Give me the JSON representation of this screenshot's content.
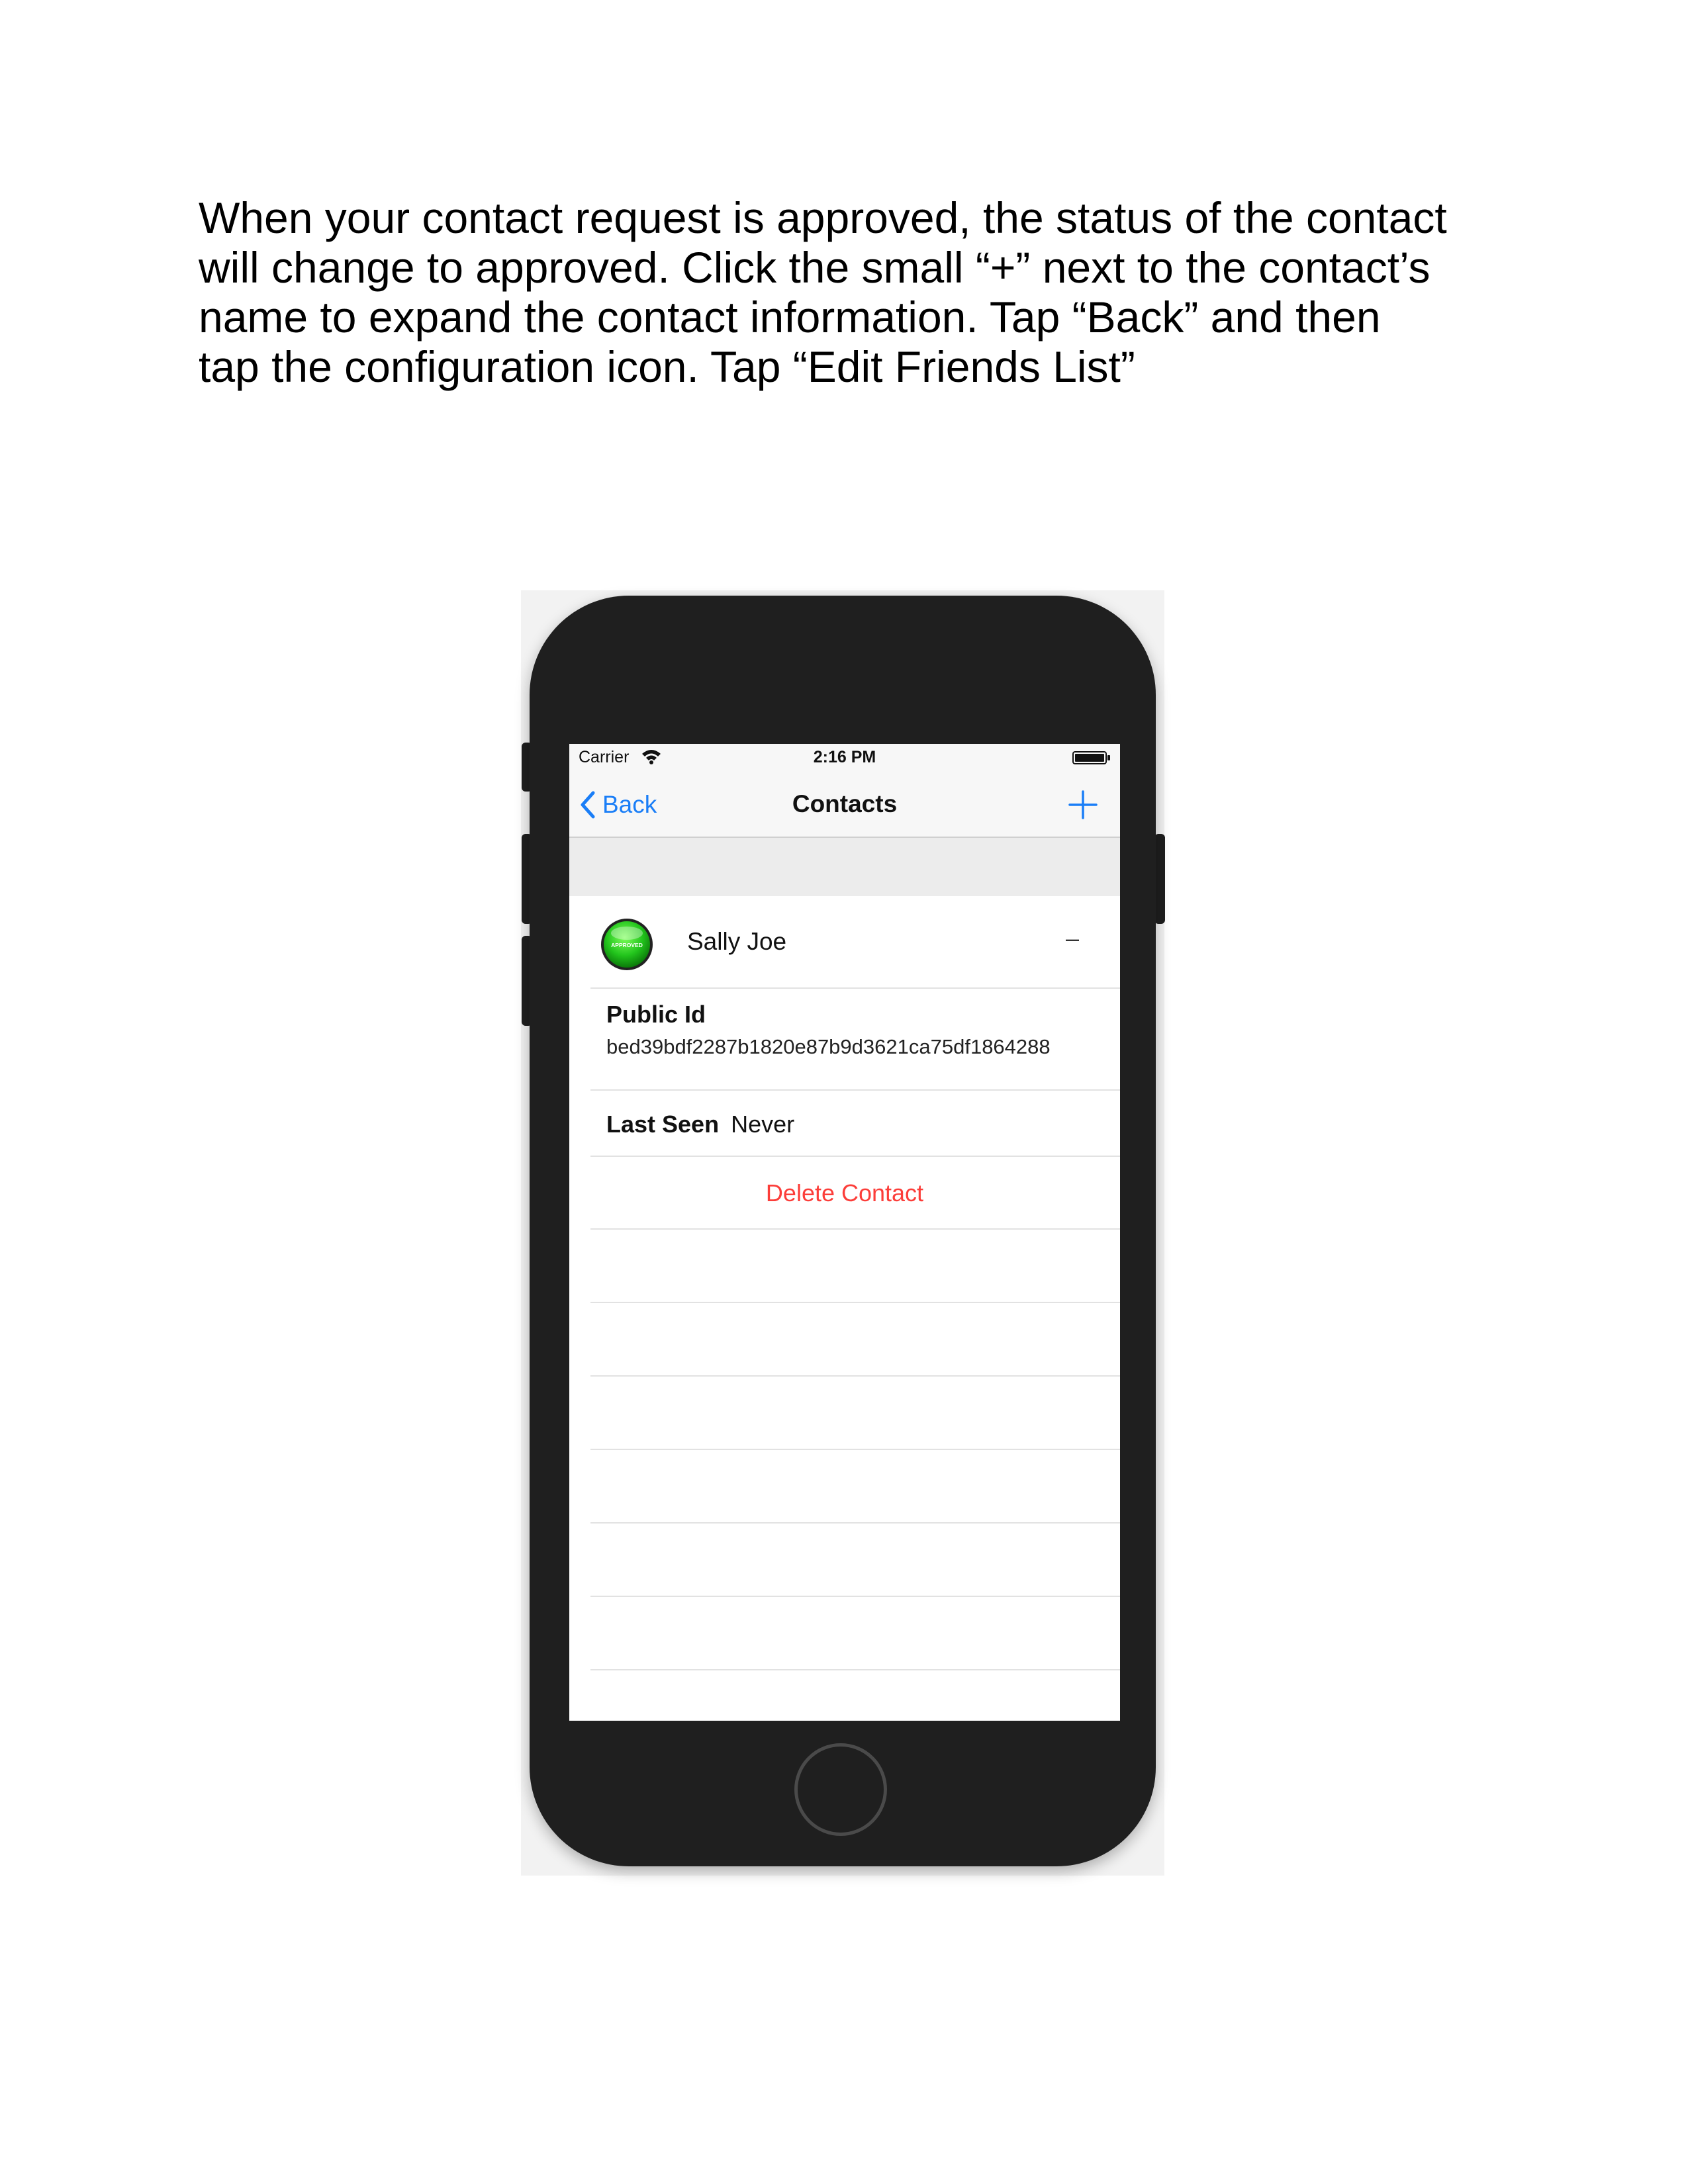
{
  "instructions": {
    "lines": [
      "When your contact request is approved, the status of the contact",
      "will change to approved. Click the small “+” next to the contact’s",
      "name to expand the contact information. Tap “Back” and then",
      "tap the configuration icon. Tap “Edit Friends List”"
    ]
  },
  "status_bar": {
    "carrier": "Carrier",
    "time": "2:16 PM",
    "wifi_icon": "wifi-icon",
    "battery_icon": "battery-icon"
  },
  "nav_bar": {
    "back_label": "Back",
    "title": "Contacts",
    "add_icon": "plus-icon"
  },
  "contact": {
    "name": "Sally Joe",
    "badge_text": "APPROVED",
    "badge_color": "#22c41c",
    "collapse_symbol": "–",
    "public_id_label": "Public Id",
    "public_id_value": "bed39bdf2287b1820e87b9d3621ca75df1864288",
    "last_seen_label": "Last Seen",
    "last_seen_value": "Never",
    "delete_label": "Delete Contact"
  },
  "colors": {
    "accent": "#1a7ef7",
    "destructive": "#fc3d39",
    "phone_body": "#1f1f1f"
  }
}
